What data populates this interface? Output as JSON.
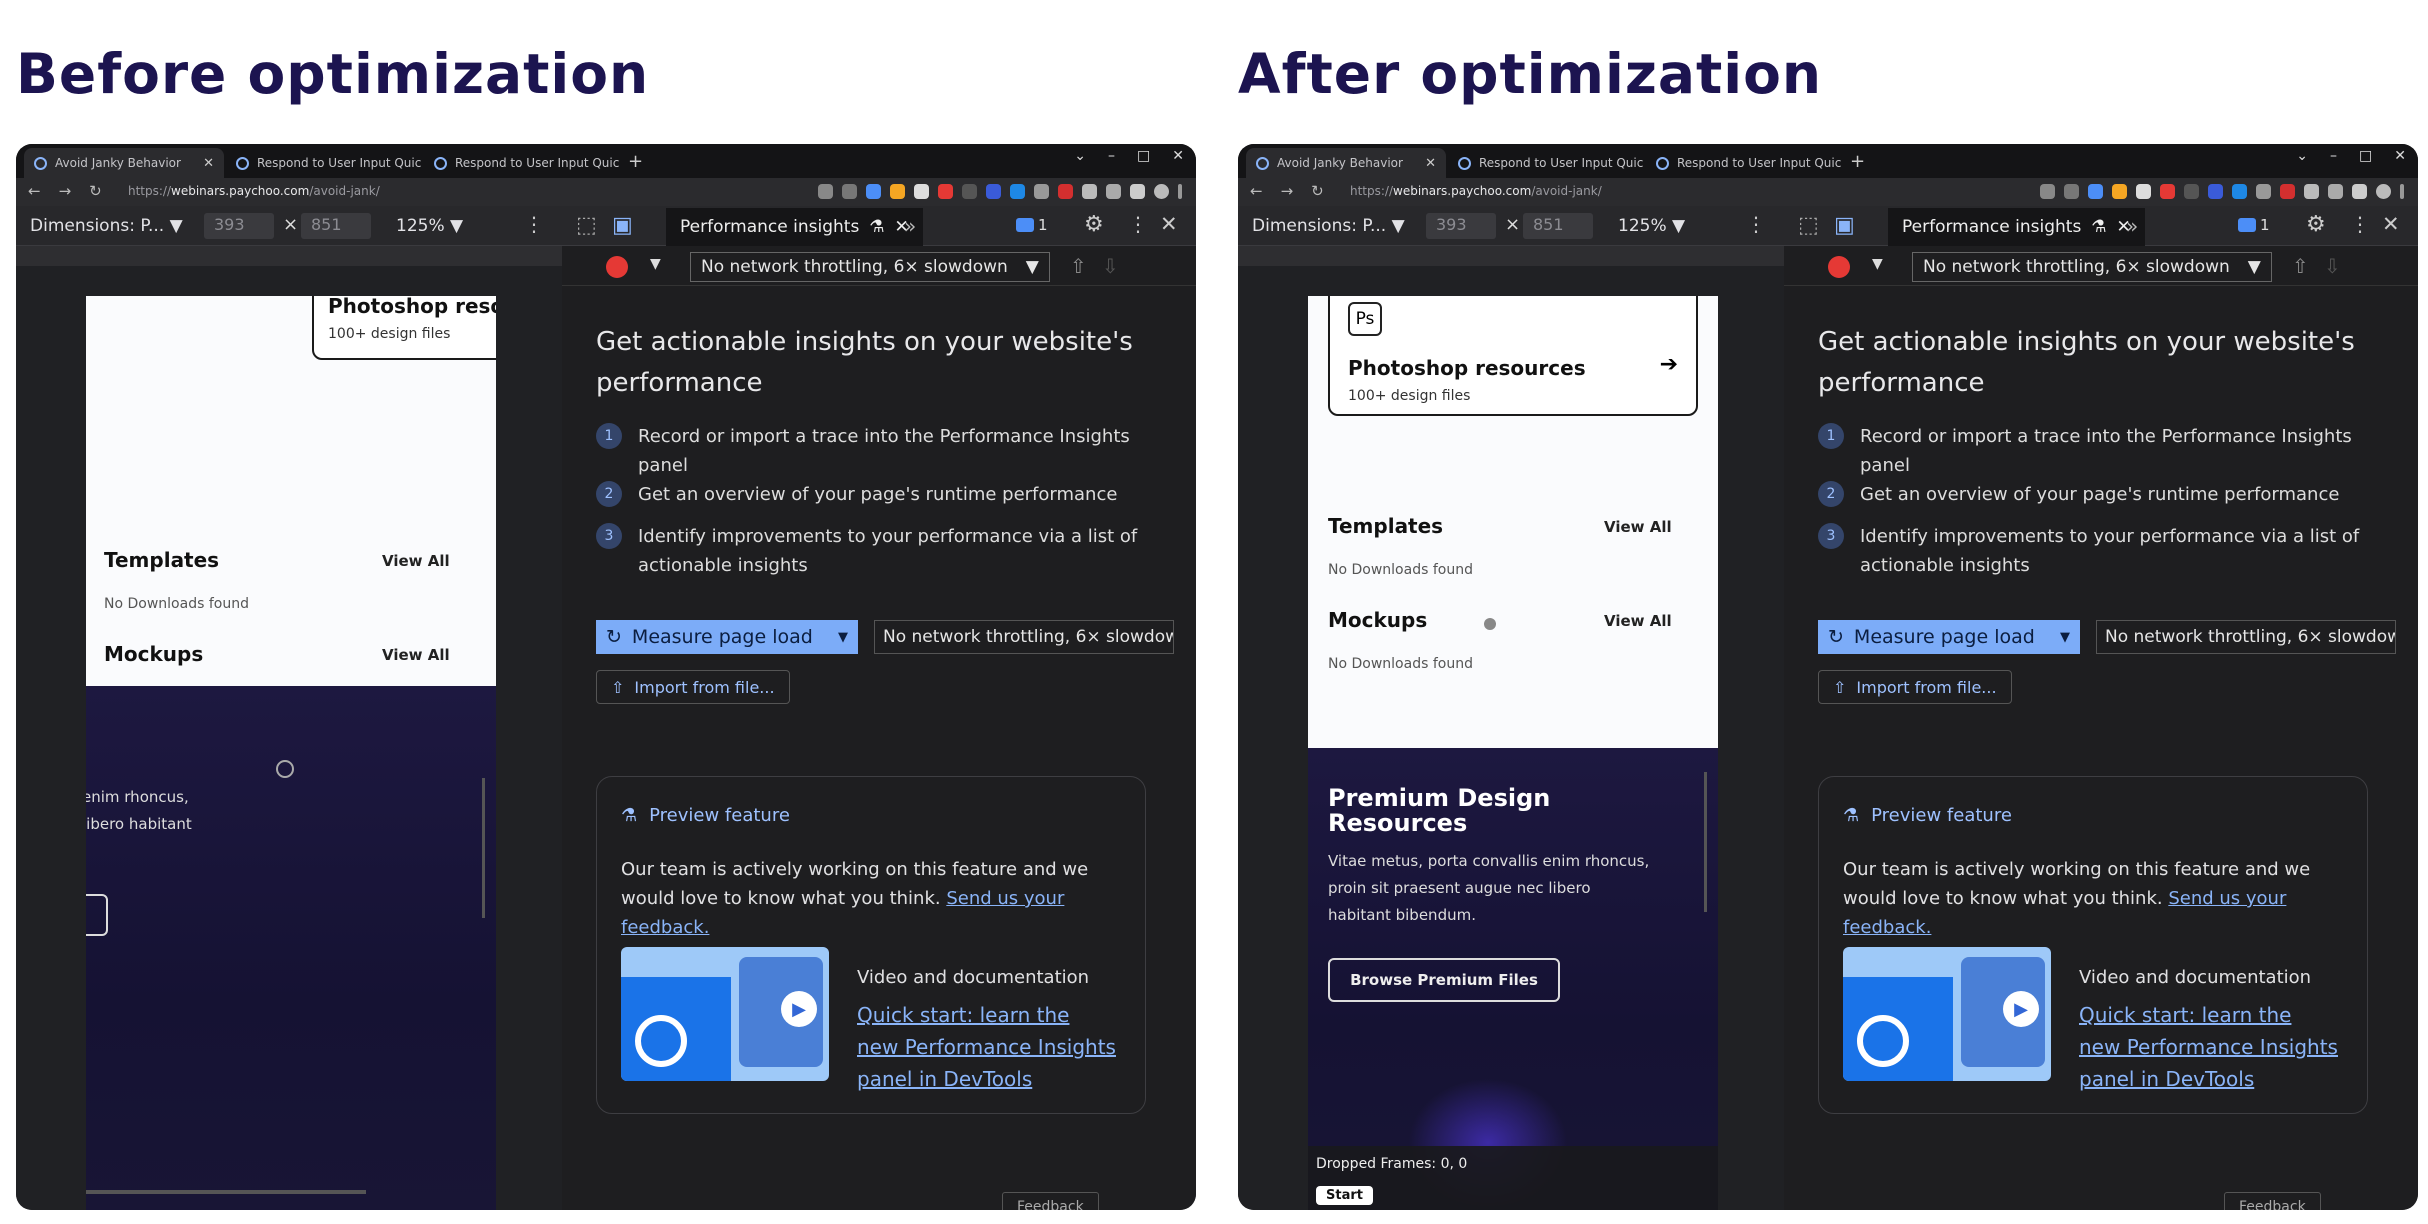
{
  "before": {
    "heading": "Before optimization"
  },
  "after": {
    "heading": "After optimization"
  },
  "browser": {
    "tabs": [
      {
        "title": "Avoid Janky Behavior"
      },
      {
        "title": "Respond to User Input Quick"
      },
      {
        "title": "Respond to User Input Quick"
      }
    ],
    "new_tab": "+",
    "window_controls": {
      "minimize": "–",
      "maximize": "□",
      "close": "✕"
    },
    "url_scheme": "https://",
    "url_host": "webinars.paychoo.com",
    "url_path": "/avoid-jank/"
  },
  "device_toolbar": {
    "dimensions": "Dimensions: P... ▼",
    "width": "393",
    "times": "×",
    "height": "851",
    "zoom": "125% ▼"
  },
  "devtools": {
    "panel_tab": "Performance insights",
    "issues_count": "1",
    "throttling": "No network throttling, 6× slowdown"
  },
  "insights": {
    "headline": "Get actionable insights on your website's performance",
    "steps": [
      {
        "n": "1",
        "text": "Record or import a trace into the Performance Insights panel"
      },
      {
        "n": "2",
        "text": "Get an overview of your page's runtime performance"
      },
      {
        "n": "3",
        "text": "Identify improvements to your performance via a list of actionable insights"
      }
    ],
    "measure_label": "Measure page load",
    "import_label": "Import from file...",
    "preview_title": "Preview feature",
    "preview_text": "Our team is actively working on this feature and we would love to know what you think.",
    "feedback_link": "Send us your feedback.",
    "video_title": "Video and documentation",
    "video_link": "Quick start: learn the new Performance Insights panel in DevTools",
    "feedback_button": "Feedback"
  },
  "site": {
    "ps_badge": "Ps",
    "card_title": "Photoshop resources",
    "card_title_cut": "Photoshop reso",
    "card_sub": "100+ design files",
    "templates": "Templates",
    "mockups": "Mockups",
    "view_all": "View All",
    "no_downloads": "No Downloads found",
    "premium_title": "Premium Design Resources",
    "premium_text": "Vitae metus, porta convallis enim rhoncus, proin sit praesent augue nec libero habitant bibendum.",
    "premium_text_cut1": "enim rhoncus,",
    "premium_text_cut2": "libero habitant",
    "browse_label": "Browse Premium Files",
    "dropped_frames": "Dropped Frames: 0, 0",
    "start_label": "Start"
  },
  "colors": {
    "heading": "#1c1450",
    "accent_blue": "#7cacf8",
    "record_red": "#e53935",
    "link": "#8ab4f8"
  }
}
